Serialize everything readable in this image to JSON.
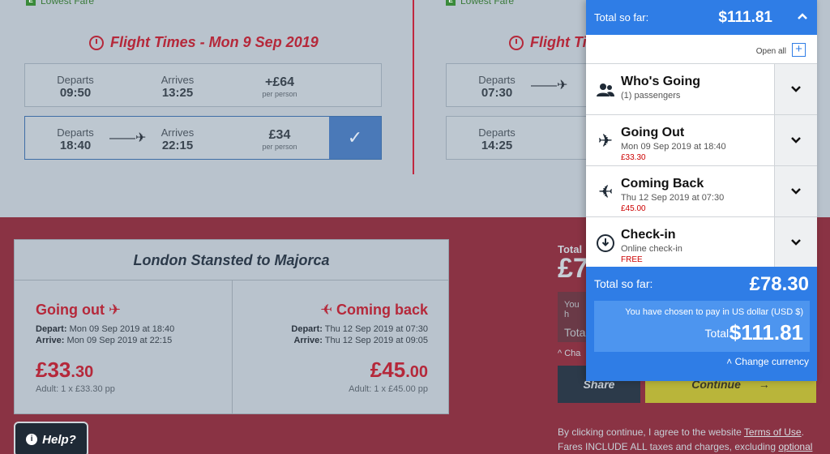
{
  "background": {
    "lowest_fare_left": "Lowest Fare",
    "lowest_fare_right": "Lowest Fare",
    "lowest_fare_badge": "E",
    "flight_times_title": "Flight Times - Mon 9 Sep 2019",
    "flight_times_title_right": "Flight Times",
    "outbound_rows": [
      {
        "departs_label": "Departs",
        "departs": "09:50",
        "arrives_label": "Arrives",
        "arrives": "13:25",
        "price": "+£64",
        "per": "per person"
      },
      {
        "departs_label": "Departs",
        "departs": "18:40",
        "arrives_label": "Arrives",
        "arrives": "22:15",
        "price": "£34",
        "per": "per person",
        "check": "✓"
      }
    ],
    "return_rows": [
      {
        "departs_label": "Departs",
        "departs": "07:30"
      },
      {
        "departs_label": "Departs",
        "departs": "14:25"
      }
    ]
  },
  "summary": {
    "route": "London Stansted to Majorca",
    "going_out": {
      "title": "Going out",
      "depart_label": "Depart:",
      "depart": "Mon 09 Sep 2019 at 18:40",
      "arrive_label": "Arrive:",
      "arrive": "Mon 09 Sep 2019 at 22:15",
      "price_main": "£33",
      "price_dec": ".30",
      "adult": "Adult: 1 x £33.30 pp"
    },
    "coming_back": {
      "title": "Coming back",
      "depart_label": "Depart:",
      "depart": "Thu 12 Sep 2019 at 07:30",
      "arrive_label": "Arrive:",
      "arrive": "Thu 12 Sep 2019 at 09:05",
      "price_main": "£45",
      "price_dec": ".00",
      "adult": "Adult: 1 x £45.00 pp"
    }
  },
  "right_bg": {
    "total_label": "Total",
    "total_peek": "£7",
    "pay_peek_1": "You h",
    "pay_peek_2": "Tota",
    "change_peek": "^ Cha",
    "share": "Share",
    "continue": "Continue",
    "terms_pre": "By clicking continue, I agree to the website ",
    "terms_link": "Terms of Use",
    "terms_mid": ". Fares INCLUDE ALL taxes and charges, excluding ",
    "terms_link2": "optional extras",
    "terms_end": "."
  },
  "help": {
    "label": "Help?"
  },
  "panel": {
    "header_label": "Total so far:",
    "header_amount": "$111.81",
    "open_all": "Open all",
    "sections": [
      {
        "title": "Who's Going",
        "sub": "(1) passengers",
        "red": ""
      },
      {
        "title": "Going Out",
        "sub": "Mon 09 Sep 2019 at 18:40",
        "red": "£33.30"
      },
      {
        "title": "Coming Back",
        "sub": "Thu 12 Sep 2019 at 07:30",
        "red": "£45.00"
      },
      {
        "title": "Check-in",
        "sub": "Online check-in",
        "red": "FREE"
      }
    ],
    "footer_label": "Total so far:",
    "footer_amount": "£78.30",
    "pay_message": "You have chosen to pay in US dollar (USD $)",
    "pay_total_label": "Total:",
    "pay_total": "$111.81",
    "change_currency": "Change currency"
  },
  "colors": {
    "accent": "#2f7de6",
    "brand_red": "#b5283a"
  }
}
